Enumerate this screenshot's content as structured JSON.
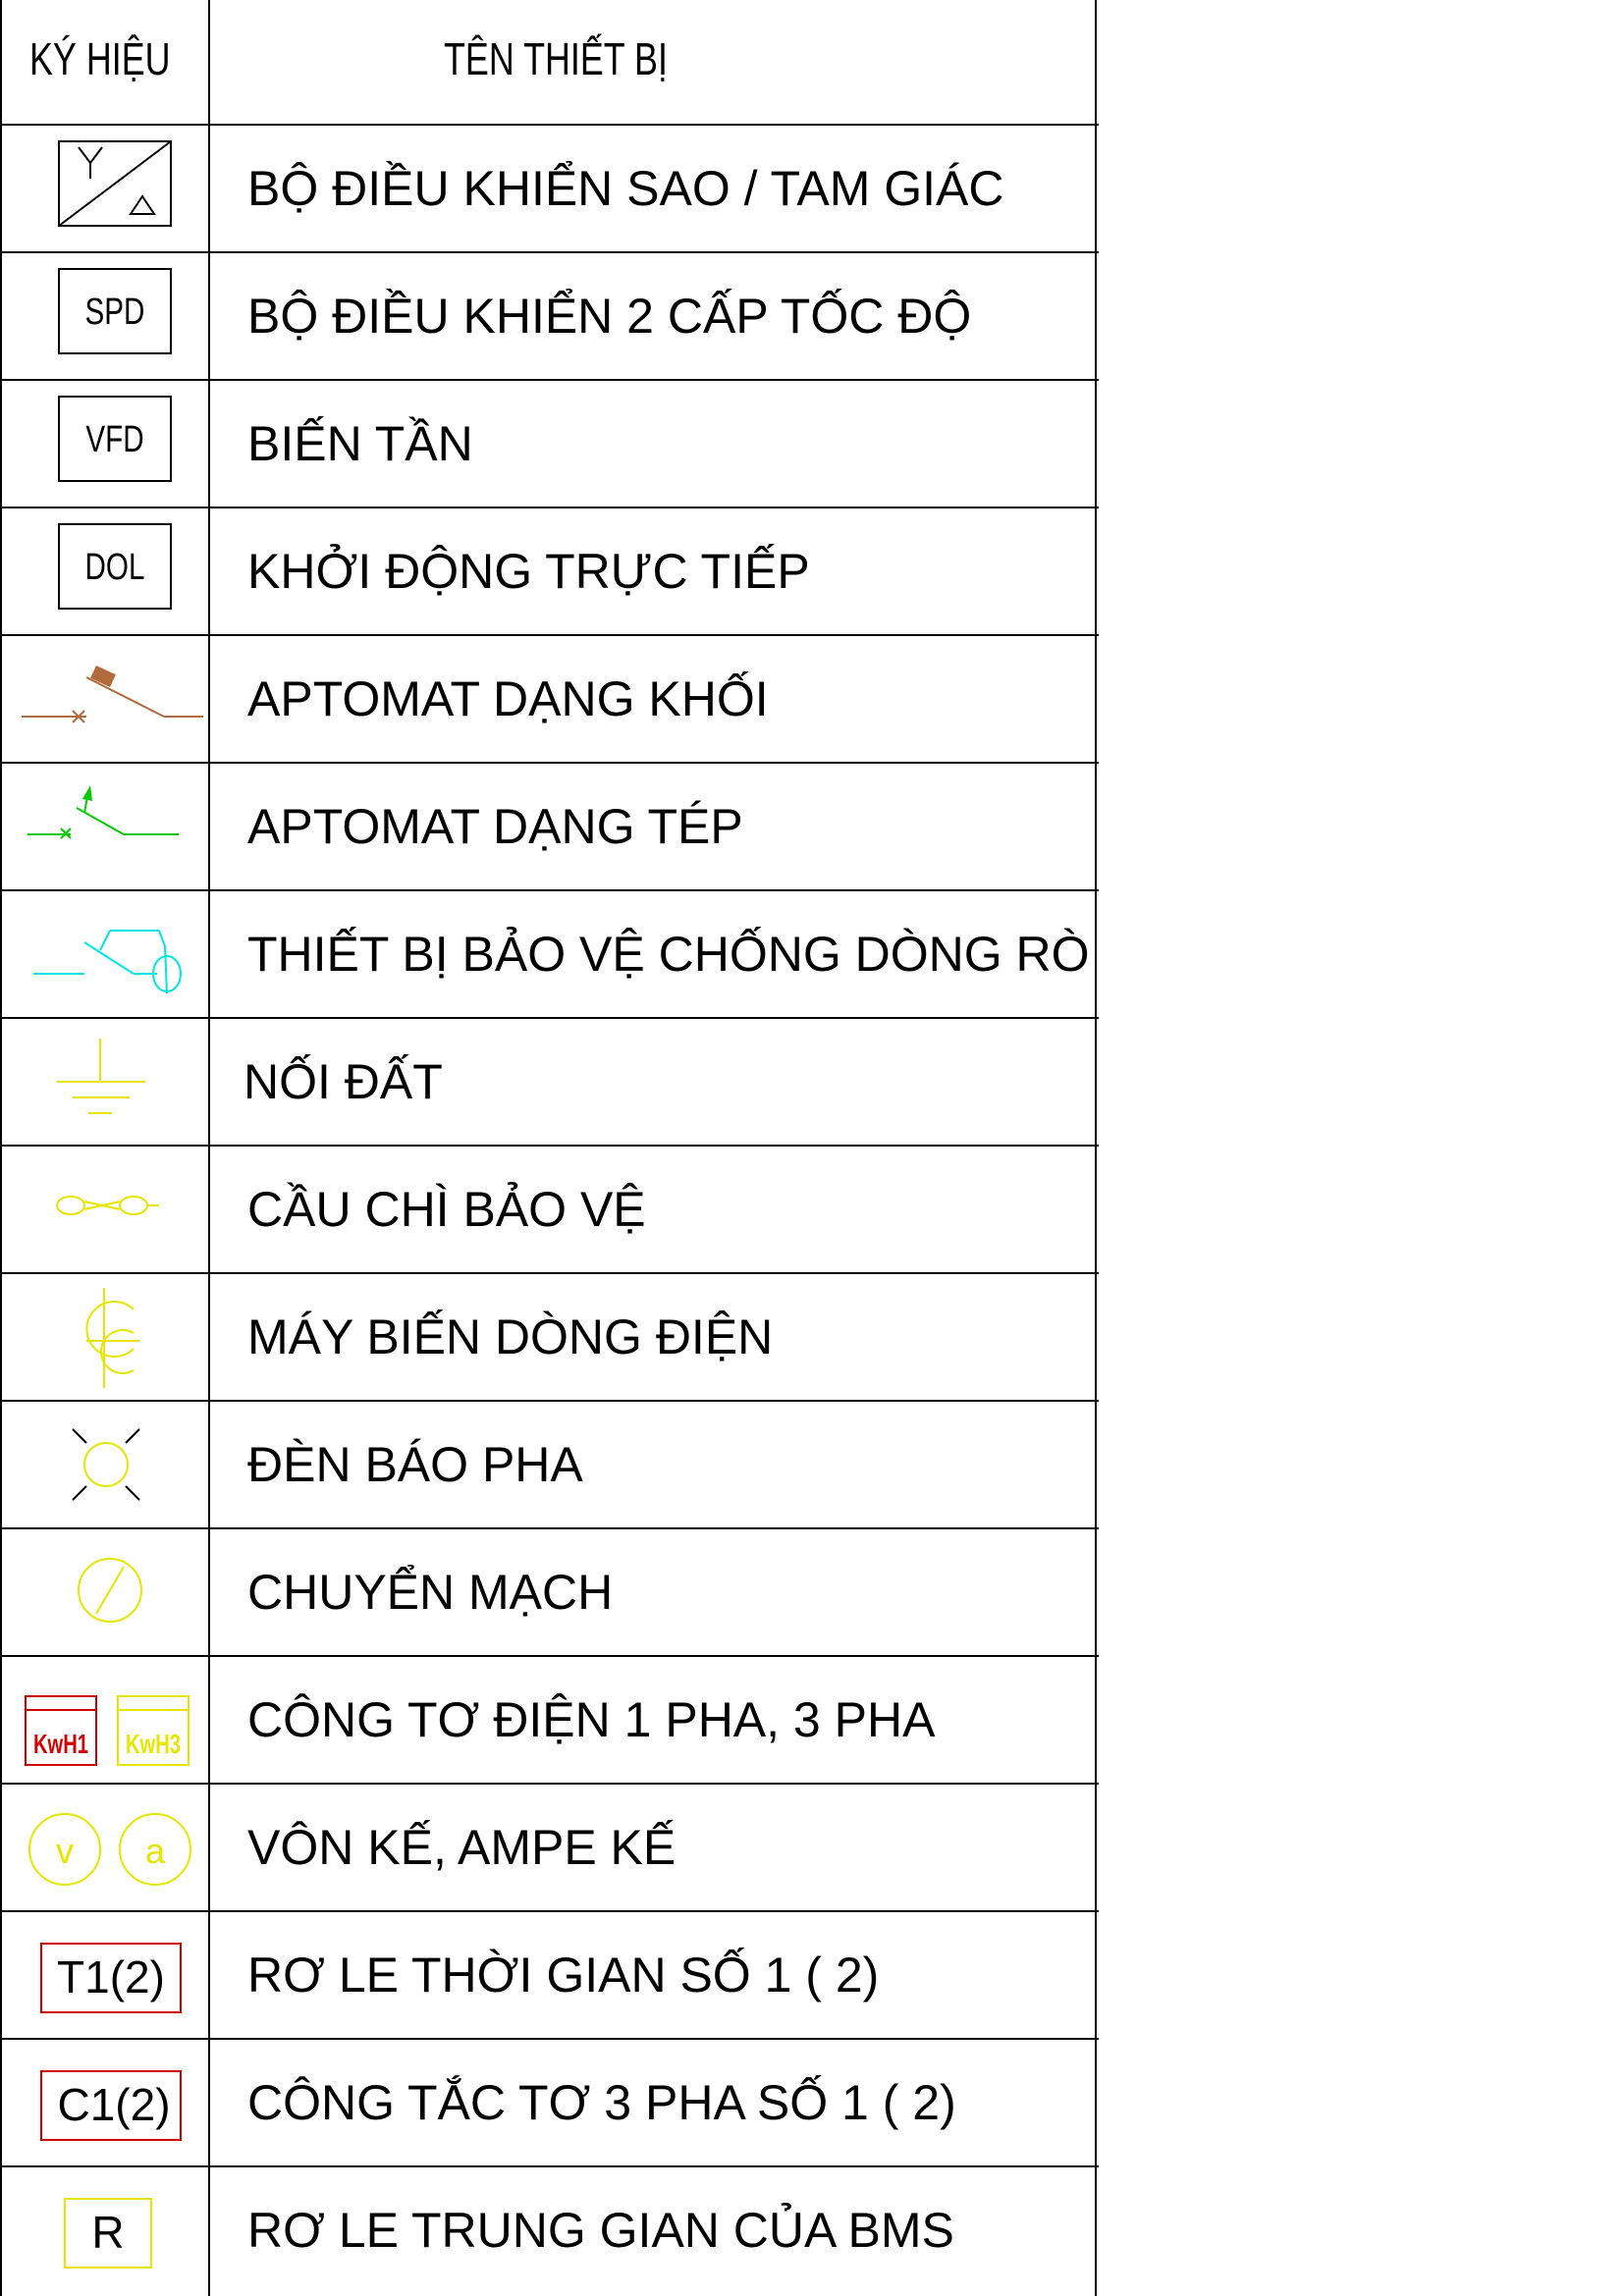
{
  "header": {
    "symbol_col": "KÝ HIỆU",
    "name_col": "TÊN THIẾT BỊ"
  },
  "rows": [
    {
      "symbol": "star-delta-icon",
      "name": "BỘ ĐIỀU KHIỂN SAO / TAM GIÁC"
    },
    {
      "symbol": "SPD",
      "name": "BỘ ĐIỀU KHIỂN 2 CẤP TỐC ĐỘ"
    },
    {
      "symbol": "VFD",
      "name": "BIẾN TẦN"
    },
    {
      "symbol": "DOL",
      "name": "KHỞI ĐỘNG TRỰC TIẾP"
    },
    {
      "symbol": "mccb-icon",
      "name": "APTOMAT DẠNG KHỐI"
    },
    {
      "symbol": "mcb-icon",
      "name": "APTOMAT DẠNG TÉP"
    },
    {
      "symbol": "rcd-icon",
      "name": "THIẾT BỊ BẢO VỆ CHỐNG DÒNG RÒ"
    },
    {
      "symbol": "earth-icon",
      "name": "NỐI ĐẤT"
    },
    {
      "symbol": "fuse-icon",
      "name": "CẦU CHÌ BẢO VỆ"
    },
    {
      "symbol": "current-transformer-icon",
      "name": "MÁY BIẾN DÒNG ĐIỆN"
    },
    {
      "symbol": "phase-lamp-icon",
      "name": "ĐÈN BÁO PHA"
    },
    {
      "symbol": "selector-switch-icon",
      "name": "CHUYỂN MẠCH"
    },
    {
      "symbol": "KwH1 / KwH3",
      "label_1": "KwH1",
      "label_3": "KwH3",
      "name": "CÔNG TƠ ĐIỆN 1 PHA, 3 PHA"
    },
    {
      "symbol": "voltmeter-ammeter-icon",
      "label_v": "v",
      "label_a": "a",
      "name": "VÔN KẾ, AMPE KẾ"
    },
    {
      "symbol": "T1(2)",
      "name": "RƠ LE THỜI GIAN SỐ 1 ( 2)"
    },
    {
      "symbol": "C1(2)",
      "name": "CÔNG TẮC TƠ 3 PHA SỐ 1 ( 2)"
    },
    {
      "symbol": "R",
      "name": "RƠ LE TRUNG GIAN CỦA BMS"
    }
  ],
  "colors": {
    "brown": "#b06a3b",
    "green": "#00cc00",
    "cyan": "#00e5e5",
    "yellow": "#e6e600",
    "red": "#d40000",
    "black": "#000000"
  }
}
